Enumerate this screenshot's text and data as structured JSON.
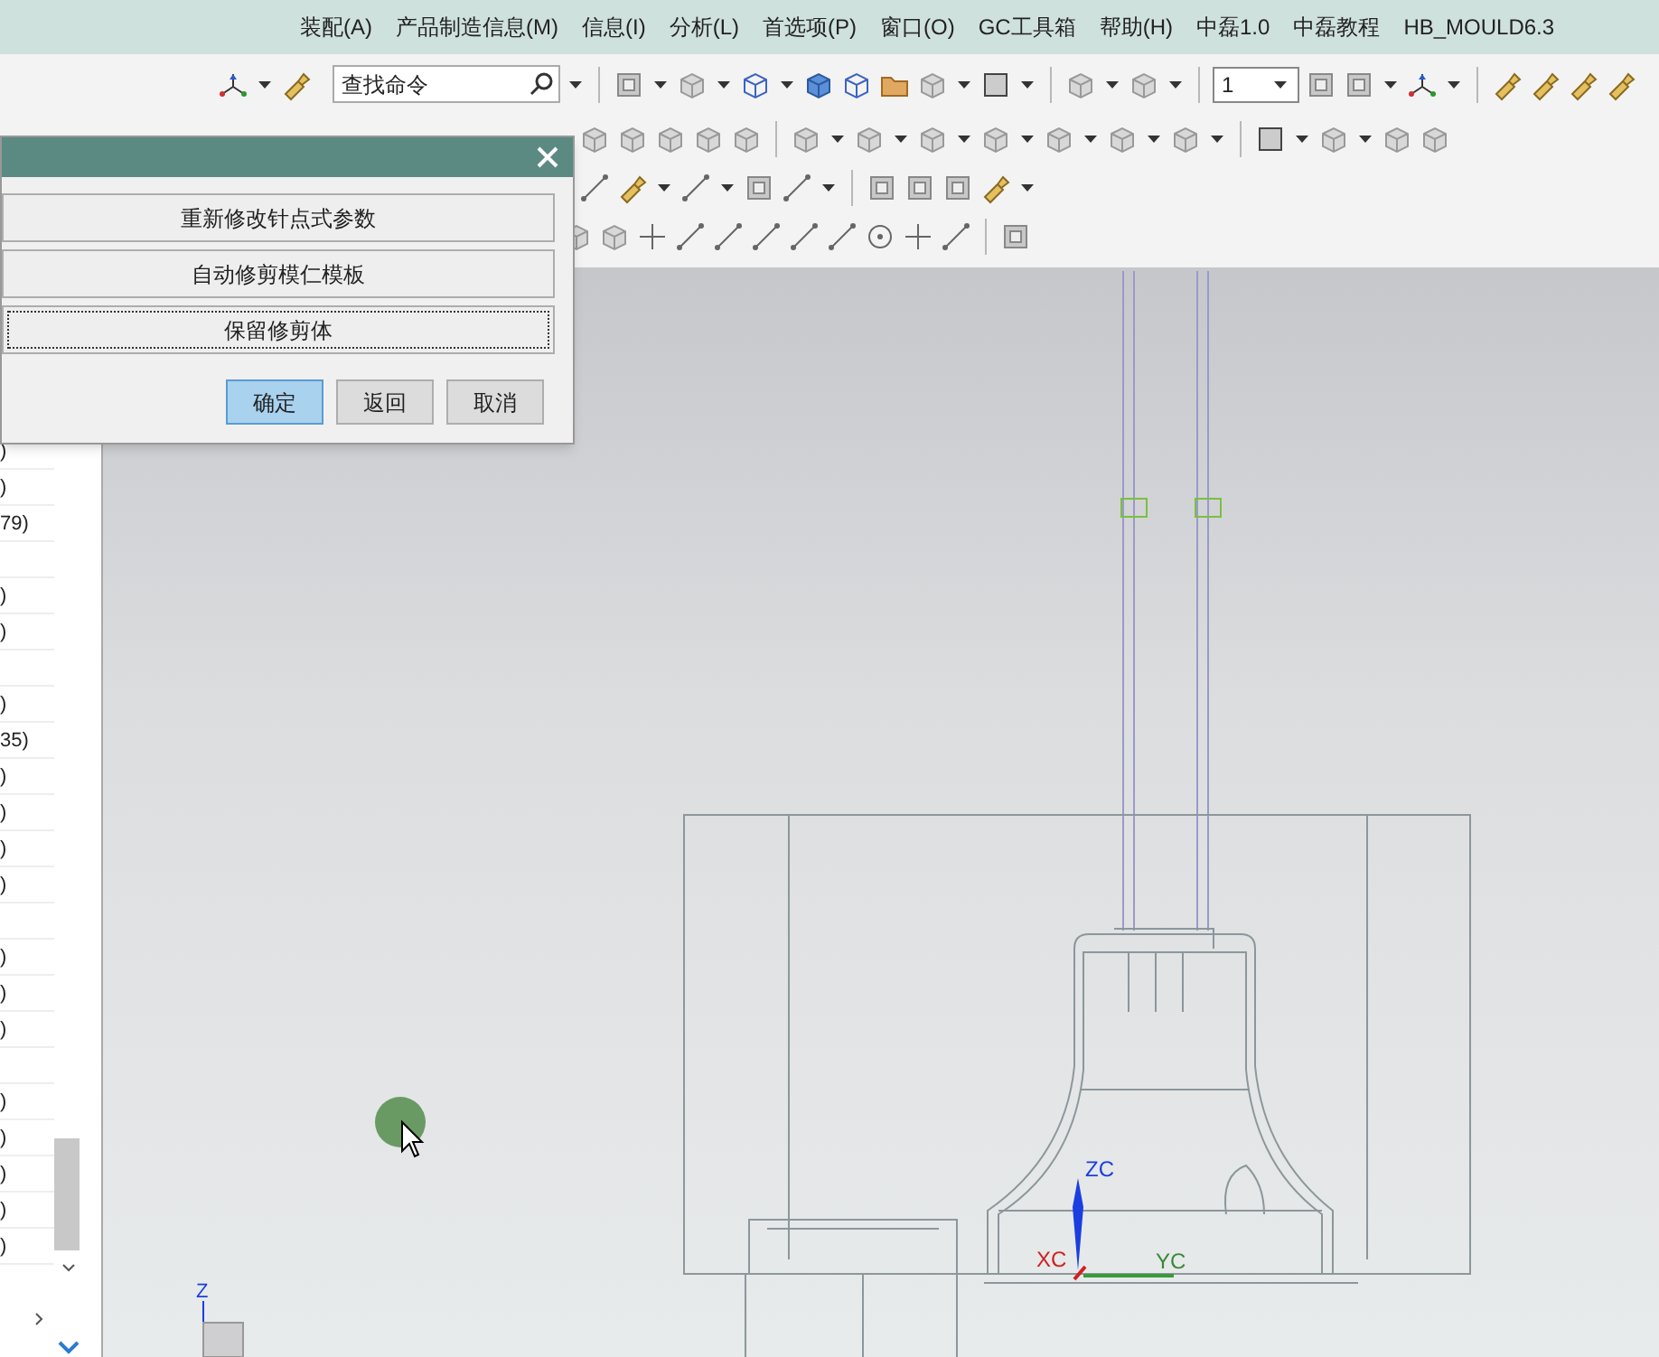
{
  "menu_bar": {
    "items": [
      {
        "label": "装配(A)"
      },
      {
        "label": "产品制造信息(M)"
      },
      {
        "label": "信息(I)"
      },
      {
        "label": "分析(L)"
      },
      {
        "label": "首选项(P)"
      },
      {
        "label": "窗口(O)"
      },
      {
        "label": "GC工具箱"
      },
      {
        "label": "帮助(H)"
      },
      {
        "label": "中磊1.0"
      },
      {
        "label": "中磊教程"
      },
      {
        "label": "HB_MOULD6.3"
      }
    ]
  },
  "toolbar": {
    "search": {
      "placeholder": "查找命令"
    },
    "layer_select": {
      "value": "1"
    }
  },
  "navigator": {
    "rows": [
      {
        "text": ")"
      },
      {
        "text": ")"
      },
      {
        "text": "79)"
      },
      {},
      {
        "text": ")"
      },
      {
        "text": ")"
      },
      {},
      {
        "text": ")"
      },
      {
        "text": "35)"
      },
      {
        "text": ")"
      },
      {
        "text": ")"
      },
      {
        "text": ")"
      },
      {
        "text": ")"
      },
      {},
      {
        "text": ")"
      },
      {
        "text": ")"
      },
      {
        "text": ")"
      },
      {},
      {
        "text": ")"
      },
      {
        "text": ")"
      },
      {
        "text": ")"
      },
      {
        "text": ")"
      },
      {
        "text": ")"
      }
    ]
  },
  "dialog": {
    "options": [
      {
        "label": "重新修改针点式参数",
        "focused": false
      },
      {
        "label": "自动修剪模仁模板",
        "focused": false
      },
      {
        "label": "保留修剪体",
        "focused": true
      }
    ],
    "buttons": [
      {
        "label": "确定",
        "default": true
      },
      {
        "label": "返回",
        "default": false
      },
      {
        "label": "取消",
        "default": false
      }
    ]
  },
  "viewport": {
    "triad": {
      "z": "ZC",
      "x": "XC",
      "y": "YC"
    },
    "view_axis": "Z"
  }
}
